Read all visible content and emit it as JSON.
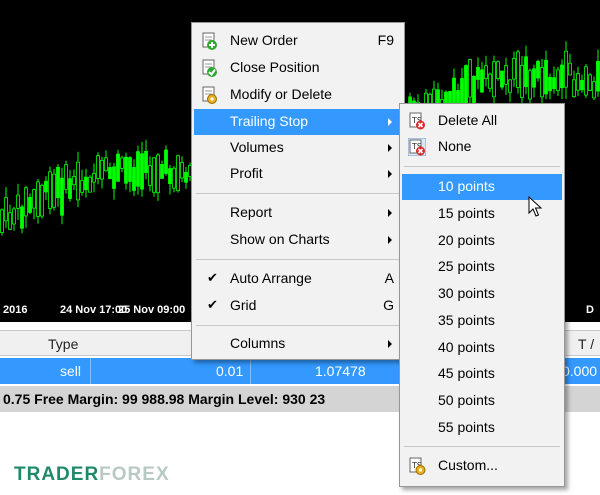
{
  "chart": {
    "time_labels": [
      "2016",
      "24 Nov 17:00",
      "25 Nov 09:00",
      "D"
    ]
  },
  "table": {
    "header_type": "Type",
    "header_tp": "T /",
    "row": {
      "type": "sell",
      "volume": "0.01",
      "price": "1.07478",
      "tp": "0.000"
    },
    "status": "0.75  Free Margin: 99 988.98  Margin Level: 930 23"
  },
  "context_menu": {
    "new_order": {
      "label": "New Order",
      "shortcut": "F9",
      "icon": "new-order-icon"
    },
    "close_position": {
      "label": "Close Position",
      "icon": "close-position-icon"
    },
    "modify_delete": {
      "label": "Modify or Delete",
      "icon": "modify-order-icon"
    },
    "trailing_stop": {
      "label": "Trailing Stop"
    },
    "volumes": {
      "label": "Volumes"
    },
    "profit": {
      "label": "Profit"
    },
    "report": {
      "label": "Report"
    },
    "show_on_charts": {
      "label": "Show on Charts"
    },
    "auto_arrange": {
      "label": "Auto Arrange",
      "shortcut": "A"
    },
    "grid": {
      "label": "Grid",
      "shortcut": "G"
    },
    "columns": {
      "label": "Columns"
    }
  },
  "trailing_submenu": {
    "delete_all": {
      "label": "Delete All",
      "icon": "delete-all-icon"
    },
    "none": {
      "label": "None",
      "icon": "none-icon"
    },
    "points": [
      "10 points",
      "15 points",
      "20 points",
      "25 points",
      "30 points",
      "35 points",
      "40 points",
      "45 points",
      "50 points",
      "55 points"
    ],
    "custom": {
      "label": "Custom...",
      "icon": "custom-icon"
    }
  },
  "watermark": {
    "part1": "TRADER",
    "part2": "FOREX"
  },
  "colors": {
    "highlight": "#3399ff",
    "candle": "#00ff00",
    "background": "#000000",
    "brand": "#1e8a6a"
  }
}
